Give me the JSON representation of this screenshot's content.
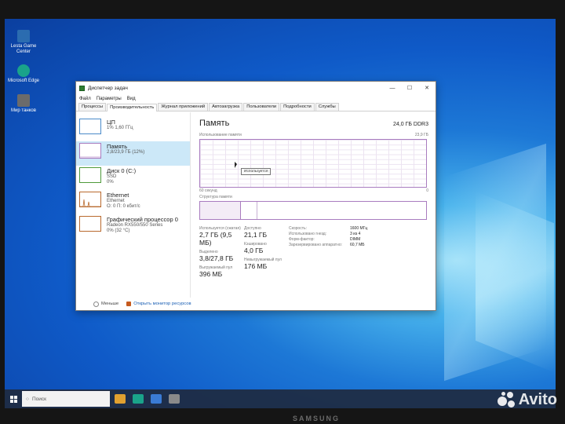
{
  "desktop": {
    "icons": [
      {
        "label": "Lesta Game Center",
        "color": "#2b6cb0"
      },
      {
        "label": "Microsoft Edge",
        "color": "#1aa38a"
      },
      {
        "label": "Мир танков",
        "color": "#6b6b6b"
      }
    ]
  },
  "window": {
    "title": "Диспетчер задач",
    "controls": {
      "minimize": "—",
      "maximize": "☐",
      "close": "✕"
    },
    "menu": [
      "Файл",
      "Параметры",
      "Вид"
    ],
    "tabs": [
      "Процессы",
      "Производительность",
      "Журнал приложений",
      "Автозагрузка",
      "Пользователи",
      "Подробности",
      "Службы"
    ],
    "active_tab": "Производительность"
  },
  "sidebar": {
    "items": [
      {
        "name": "ЦП",
        "line1": "1% 1,60 ГГц",
        "line2": "",
        "color": "#4a8bc9"
      },
      {
        "name": "Память",
        "line1": "2,8/23,9 ГБ (12%)",
        "line2": "",
        "color": "#a97cbf"
      },
      {
        "name": "Диск 0 (C:)",
        "line1": "SSD",
        "line2": "0%",
        "color": "#4f9a3b"
      },
      {
        "name": "Ethernet",
        "line1": "Ethernet",
        "line2": "О: 0 П: 0 кбит/с",
        "color": "#b96a2e"
      },
      {
        "name": "Графический процессор 0",
        "line1": "Radeon RX550/550 Series",
        "line2": "0% (32 °C)",
        "color": "#b96a2e"
      }
    ]
  },
  "main": {
    "title": "Память",
    "capacity": "24,0 ГБ DDR3",
    "usage_label": "Использование памяти",
    "usage_max": "23,9 ГБ",
    "time_label": "60 секунд",
    "time_end": "0",
    "tooltip": "Используется",
    "structure_label": "Структура памяти",
    "stats": [
      {
        "label": "Используется (сжатая)",
        "value": "2,7 ГБ (9,5 МБ)"
      },
      {
        "label": "Доступно",
        "value": "21,1 ГБ"
      },
      {
        "label": "Выделено",
        "value": "3,8/27,8 ГБ"
      },
      {
        "label": "Кэшировано",
        "value": "4,0 ГБ"
      },
      {
        "label": "Выгружаемый пул",
        "value": "396 МБ"
      },
      {
        "label": "Невыгружаемый пул",
        "value": "176 МБ"
      }
    ],
    "details": [
      {
        "key": "Скорость:",
        "value": "1600 МГц"
      },
      {
        "key": "Использовано гнезд:",
        "value": "3 из 4"
      },
      {
        "key": "Форм-фактор:",
        "value": "DIMM"
      },
      {
        "key": "Зарезервировано аппаратно:",
        "value": "60,7 МБ"
      }
    ]
  },
  "footer": {
    "less": "Меньше",
    "monitor": "Открыть монитор ресурсов"
  },
  "taskbar": {
    "search_placeholder": "Поиск"
  },
  "monitor_brand": "SAMSUNG",
  "watermark": "Avito"
}
